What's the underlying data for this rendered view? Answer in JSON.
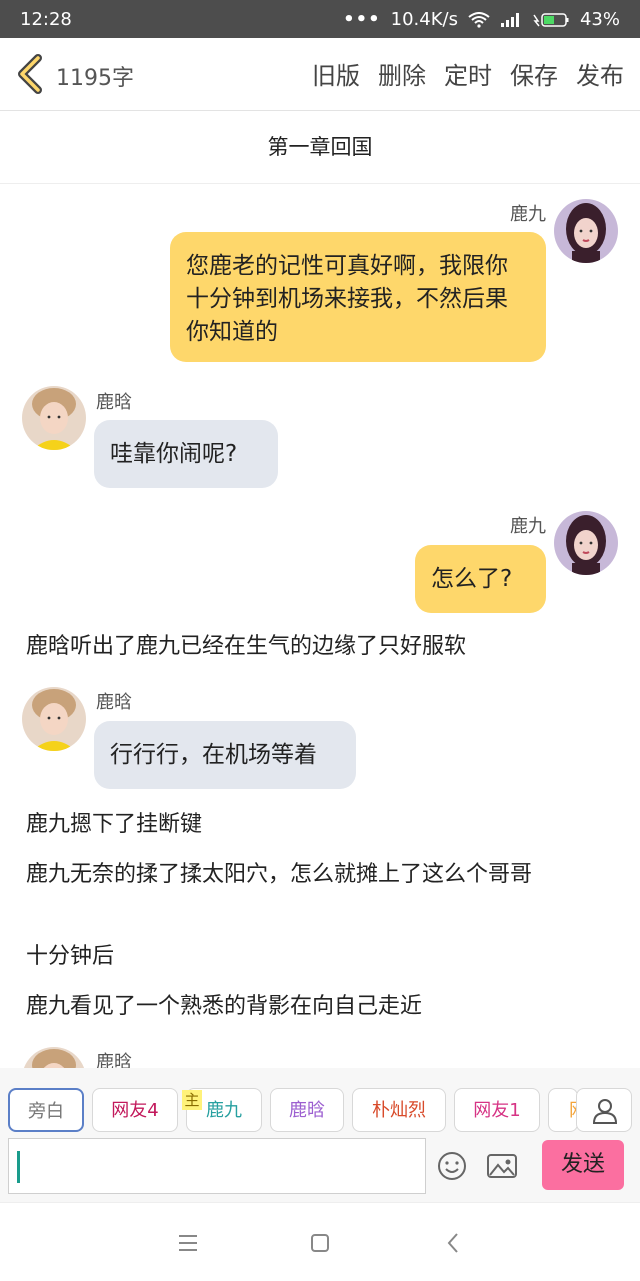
{
  "status": {
    "time": "12:28",
    "dots": "•••",
    "speed": "10.4K/s",
    "battery": "43%"
  },
  "toolbar": {
    "word_count": "1195字",
    "actions": [
      "旧版",
      "删除",
      "定时",
      "保存",
      "发布"
    ]
  },
  "chapter_title": "第一章回国",
  "messages": [
    {
      "name": "鹿九",
      "text": "您鹿老的记性可真好啊，我限你十分钟到机场来接我，不然后果你知道的"
    },
    {
      "name": "鹿晗",
      "text": "哇靠你闹呢?"
    },
    {
      "name": "鹿九",
      "text": "怎么了?"
    },
    {
      "narration": "鹿晗听出了鹿九已经在生气的边缘了只好服软"
    },
    {
      "name": "鹿晗",
      "text": "行行行，在机场等着"
    },
    {
      "narration": "鹿九摁下了挂断键"
    },
    {
      "narration": "鹿九无奈的揉了揉太阳穴，怎么就摊上了这么个哥哥"
    },
    {
      "narration": "十分钟后"
    },
    {
      "narration": "鹿九看见了一个熟悉的背影在向自己走近"
    },
    {
      "name": "鹿晗"
    }
  ],
  "roles": [
    "旁白",
    "网友4",
    "鹿九",
    "鹿晗",
    "朴灿烈",
    "网友1",
    "网"
  ],
  "role_badge": "主",
  "input": {
    "value": ""
  },
  "send_label": "发送",
  "colors": {
    "accent_yellow": "#fed76b",
    "bubble_gray": "#e3e7ee",
    "send_pink": "#fb6fa0"
  }
}
